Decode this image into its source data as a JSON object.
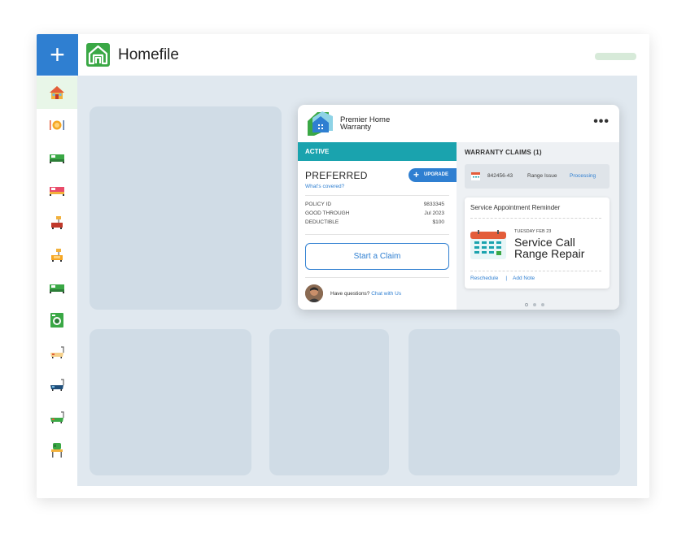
{
  "app": {
    "brand": "Homefile",
    "add_symbol": "+",
    "accent": "#2f7fd1",
    "logo_color": "#3aa845",
    "teal": "#1aa3ae"
  },
  "sidebar": {
    "items": [
      {
        "icon": "house-icon",
        "active": true
      },
      {
        "icon": "dining-icon",
        "active": false
      },
      {
        "icon": "bed-icon",
        "active": false
      },
      {
        "icon": "bed-icon",
        "active": false
      },
      {
        "icon": "lamp-icon",
        "active": false
      },
      {
        "icon": "lamp-icon",
        "active": false
      },
      {
        "icon": "bed-icon",
        "active": false
      },
      {
        "icon": "washer-icon",
        "active": false
      },
      {
        "icon": "bathtub-icon",
        "active": false
      },
      {
        "icon": "bathtub-icon",
        "active": false
      },
      {
        "icon": "bathtub-icon",
        "active": false
      },
      {
        "icon": "lawn-icon",
        "active": false
      }
    ]
  },
  "warranty": {
    "provider_line1": "Premier Home",
    "provider_line2": "Warranty",
    "menu": "•••",
    "status": "ACTIVE",
    "plan": "PREFERRED",
    "covered_link": "What's covered?",
    "upgrade_label": "UPGRADE",
    "upgrade_symbol": "+",
    "details": [
      {
        "label": "POLICY ID",
        "value": "9833345"
      },
      {
        "label": "GOOD THROUGH",
        "value": "Jul 2023"
      },
      {
        "label": "DEDUCTIBLE",
        "value": "$100"
      }
    ],
    "claim_button": "Start a Claim",
    "help_question": "Have questions?",
    "help_link": "Chat with Us"
  },
  "claims": {
    "title": "WARRANTY CLAIMS (1)",
    "items": [
      {
        "id": "842456-43",
        "issue": "Range Issue",
        "status": "Processing"
      }
    ]
  },
  "reminder": {
    "title": "Service Appointment Reminder",
    "date": "TUESDAY FEB 23",
    "line1": "Service Call",
    "line2": "Range Repair",
    "reschedule": "Reschedule",
    "separator": "|",
    "add_note": "Add Note"
  },
  "pager": {
    "total": 3,
    "current": 1
  }
}
